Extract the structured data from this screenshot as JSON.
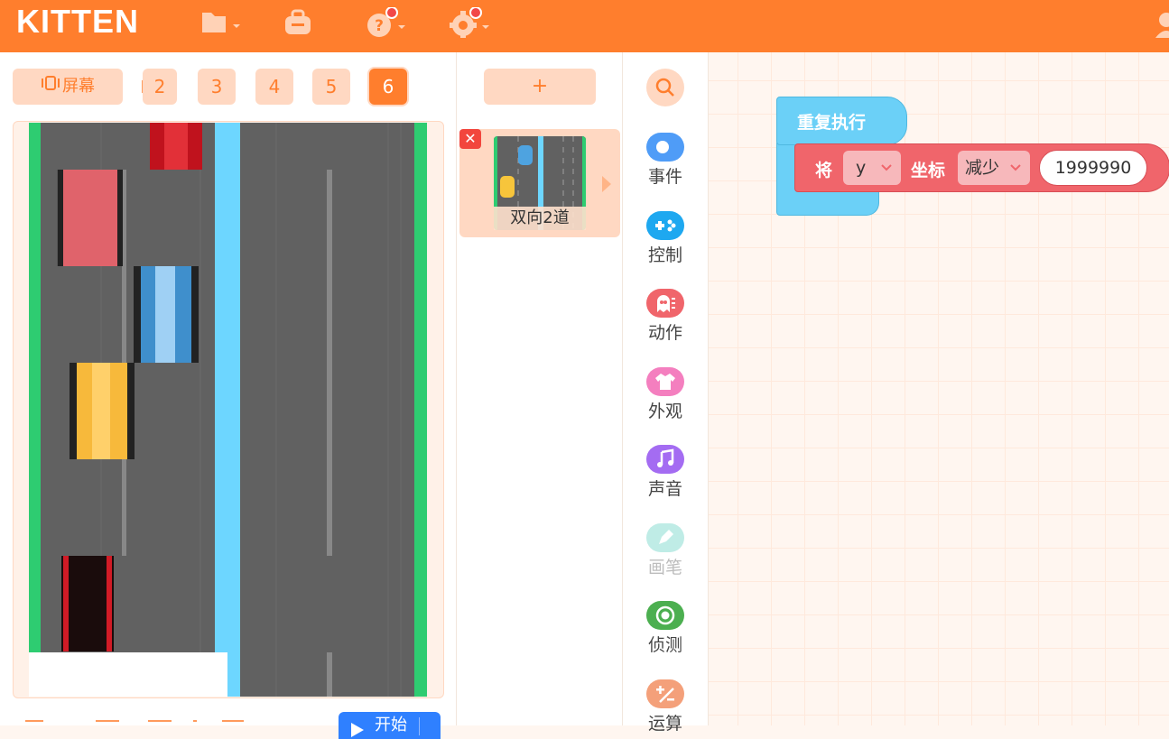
{
  "app": {
    "logo": "KITTEN"
  },
  "topbar": {
    "icons": [
      "folder-icon",
      "backpack-icon",
      "help-icon",
      "settings-icon",
      "user-icon"
    ]
  },
  "stage_panel": {
    "screen_button": "屏幕",
    "scene_tabs": [
      "2",
      "3",
      "4",
      "5",
      "6"
    ],
    "active_scene": "6",
    "start_button": "开始"
  },
  "sprite_panel": {
    "add_button": "+",
    "sprites": [
      {
        "name": "双向2道",
        "selected": true
      }
    ]
  },
  "categories": [
    {
      "label": "事件",
      "icon": "toggle-icon",
      "color": "#4f9cf7",
      "enabled": true
    },
    {
      "label": "控制",
      "icon": "gamepad-icon",
      "color": "#1ea8f0",
      "enabled": true
    },
    {
      "label": "动作",
      "icon": "ghost-icon",
      "color": "#f0656b",
      "enabled": true
    },
    {
      "label": "外观",
      "icon": "shirt-icon",
      "color": "#f47fbf",
      "enabled": true
    },
    {
      "label": "声音",
      "icon": "music-note-icon",
      "color": "#a46cf2",
      "enabled": true
    },
    {
      "label": "画笔",
      "icon": "pen-icon",
      "color": "#bfece6",
      "enabled": false
    },
    {
      "label": "侦测",
      "icon": "target-icon",
      "color": "#4caf50",
      "enabled": true
    },
    {
      "label": "运算",
      "icon": "math-icon",
      "color": "#f4a07a",
      "enabled": true
    }
  ],
  "workspace": {
    "repeat_block": {
      "label": "重复执行"
    },
    "move_block": {
      "prefix": "将",
      "axis": "y",
      "axis_label": "坐标",
      "mode": "减少",
      "value": "1999990"
    }
  },
  "colors": {
    "brand": "#ff7e2d",
    "brand_light": "#ffd8c2",
    "control_block": "#6bd0f7",
    "motion_block": "#f0656b"
  }
}
